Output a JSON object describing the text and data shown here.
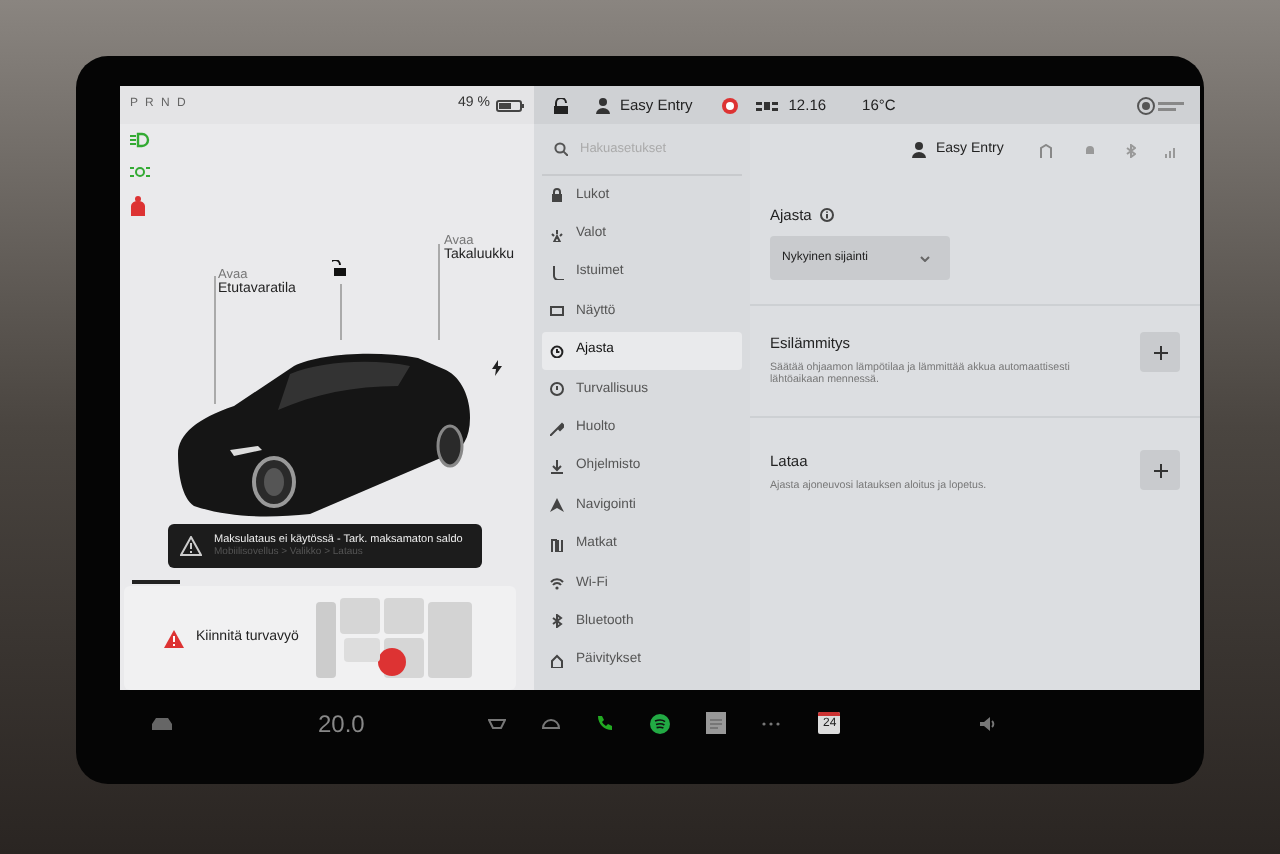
{
  "status_bar": {
    "gears": "P R N D",
    "battery": "49 %",
    "profile": "Easy Entry",
    "time": "12.16",
    "temperature": "16°C"
  },
  "left_panel": {
    "callouts": [
      {
        "action": "Avaa",
        "target": "Etutavaratila"
      },
      {
        "action": "Avaa",
        "target": "Takaluukku"
      }
    ],
    "alert": {
      "title": "Maksulataus ei käytössä - Tark. maksamaton saldo",
      "subtitle": "Mobiilisovellus > Valikko > Lataus"
    },
    "seatbelt_warning": "Kiinnitä turvavyö"
  },
  "settings_menu": {
    "search_placeholder": "Hakuasetukset",
    "items": [
      {
        "label": "Lukot",
        "selected": false
      },
      {
        "label": "Valot",
        "selected": false
      },
      {
        "label": "Istuimet",
        "selected": false
      },
      {
        "label": "Näyttö",
        "selected": false
      },
      {
        "label": "Ajasta",
        "selected": true
      },
      {
        "label": "Turvallisuus",
        "selected": false
      },
      {
        "label": "Huolto",
        "selected": false
      },
      {
        "label": "Ohjelmisto",
        "selected": false
      },
      {
        "label": "Navigointi",
        "selected": false
      },
      {
        "label": "Matkat",
        "selected": false
      },
      {
        "label": "Wi-Fi",
        "selected": false
      },
      {
        "label": "Bluetooth",
        "selected": false
      },
      {
        "label": "Päivitykset",
        "selected": false
      }
    ]
  },
  "schedule": {
    "profile": "Easy Entry",
    "title": "Ajasta",
    "location_dropdown": "Nykyinen sijainti",
    "sections": [
      {
        "title": "Esilämmitys",
        "description": "Säätää ohjaamon lämpötilaa ja lämmittää akkua automaattisesti lähtöaikaan mennessä."
      },
      {
        "title": "Lataa",
        "description": "Ajasta ajoneuvosi latauksen aloitus ja lopetus."
      }
    ]
  },
  "dock": {
    "cabin_temperature": "20.0",
    "calendar_day": "24"
  }
}
